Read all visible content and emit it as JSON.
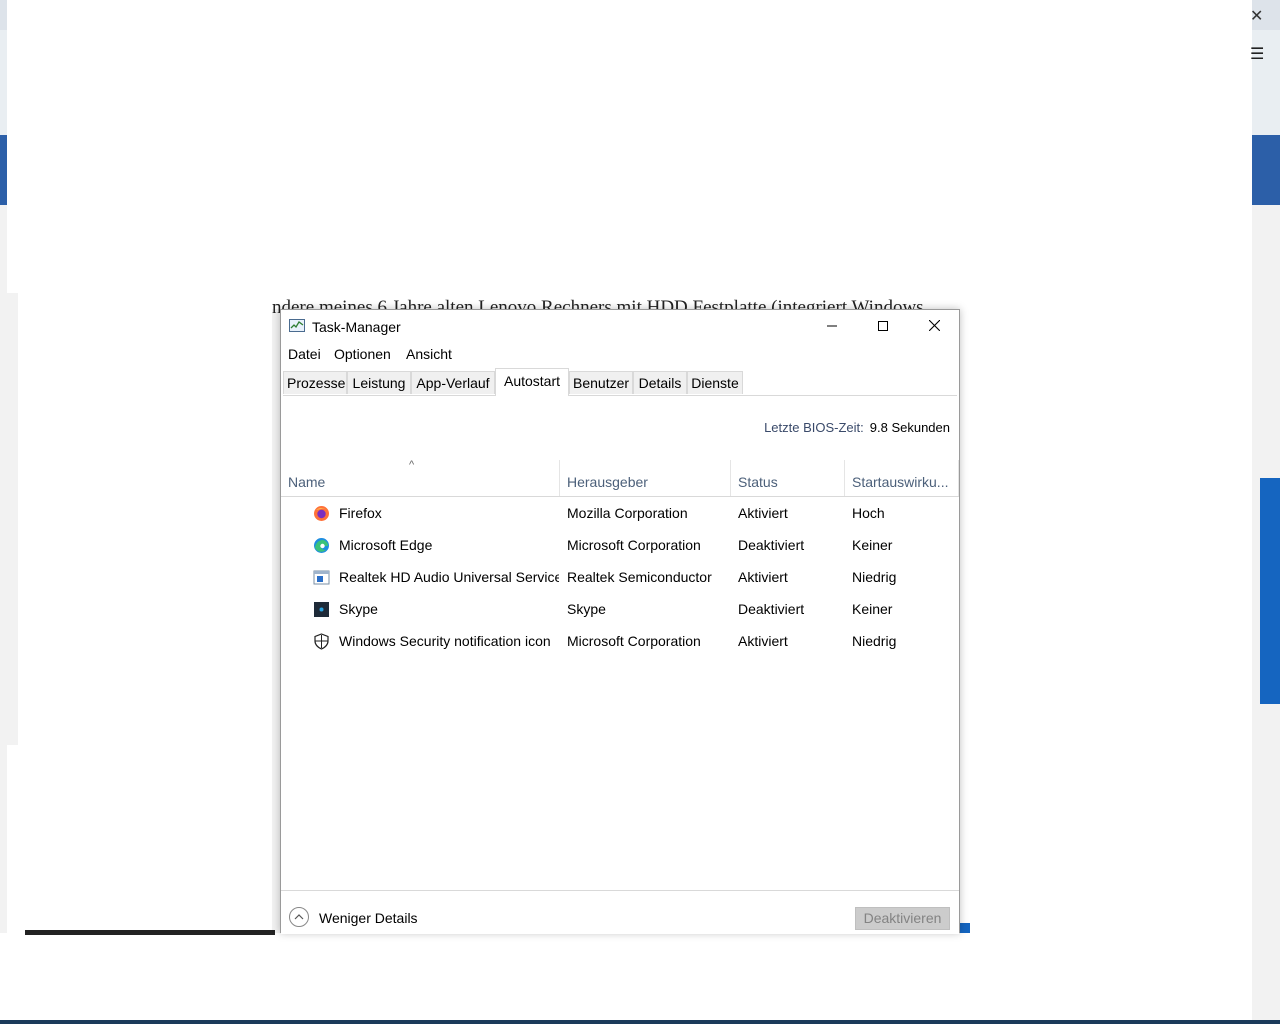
{
  "background": {
    "text_strip": "ndere meines 6 Jahre alten Lenovo Rechners mit HDD Festplatte (integriert Windows"
  },
  "window": {
    "title": "Task-Manager",
    "controls": {
      "minimize": "—",
      "maximize": "☐",
      "close": "✕"
    }
  },
  "menu": [
    "Datei",
    "Optionen",
    "Ansicht"
  ],
  "tabs": [
    {
      "label": "Prozesse",
      "active": false
    },
    {
      "label": "Leistung",
      "active": false
    },
    {
      "label": "App-Verlauf",
      "active": false
    },
    {
      "label": "Autostart",
      "active": true
    },
    {
      "label": "Benutzer",
      "active": false
    },
    {
      "label": "Details",
      "active": false
    },
    {
      "label": "Dienste",
      "active": false
    }
  ],
  "bios": {
    "label": "Letzte BIOS-Zeit:",
    "value": "9.8 Sekunden"
  },
  "table": {
    "columns": [
      "Name",
      "Herausgeber",
      "Status",
      "Startauswirku..."
    ],
    "sort_indicator": "^",
    "rows": [
      {
        "icon": "firefox-icon",
        "name": "Firefox",
        "publisher": "Mozilla Corporation",
        "status": "Aktiviert",
        "impact": "Hoch"
      },
      {
        "icon": "edge-icon",
        "name": "Microsoft Edge",
        "publisher": "Microsoft Corporation",
        "status": "Deaktiviert",
        "impact": "Keiner"
      },
      {
        "icon": "realtek-icon",
        "name": "Realtek HD Audio Universal Service",
        "publisher": "Realtek Semiconductor",
        "status": "Aktiviert",
        "impact": "Niedrig"
      },
      {
        "icon": "skype-icon",
        "name": "Skype",
        "publisher": "Skype",
        "status": "Deaktiviert",
        "impact": "Keiner"
      },
      {
        "icon": "shield-icon",
        "name": "Windows Security notification icon",
        "publisher": "Microsoft Corporation",
        "status": "Aktiviert",
        "impact": "Niedrig"
      }
    ]
  },
  "footer": {
    "less_details": "Weniger Details",
    "deactivate": "Deaktivieren"
  }
}
